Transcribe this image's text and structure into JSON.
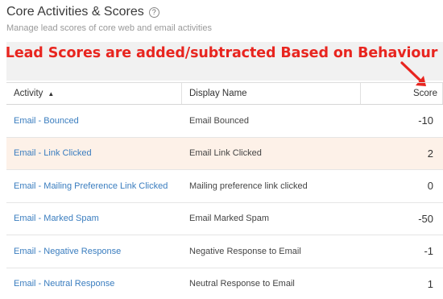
{
  "header": {
    "title": "Core Activities & Scores",
    "help_glyph": "?",
    "subtitle": "Manage lead scores of core web and email activities"
  },
  "annotation": {
    "text": "Lead Scores are added/subtracted Based on Behaviour",
    "color": "#e8251f"
  },
  "table": {
    "columns": {
      "activity": "Activity",
      "sort_glyph": "▲",
      "display_name": "Display Name",
      "score": "Score"
    },
    "rows": [
      {
        "activity": "Email - Bounced",
        "display_name": "Email Bounced",
        "score": "-10"
      },
      {
        "activity": "Email - Link Clicked",
        "display_name": "Email Link Clicked",
        "score": "2"
      },
      {
        "activity": "Email - Mailing Preference Link Clicked",
        "display_name": "Mailing preference link clicked",
        "score": "0"
      },
      {
        "activity": "Email - Marked Spam",
        "display_name": "Email Marked Spam",
        "score": "-50"
      },
      {
        "activity": "Email - Negative Response",
        "display_name": "Negative Response to Email",
        "score": "-1"
      },
      {
        "activity": "Email - Neutral Response",
        "display_name": "Neutral Response to Email",
        "score": "1"
      }
    ]
  },
  "colors": {
    "link": "#3a7dbf",
    "highlight_row": "#fdf1e8",
    "banner": "#f1f1f1"
  }
}
